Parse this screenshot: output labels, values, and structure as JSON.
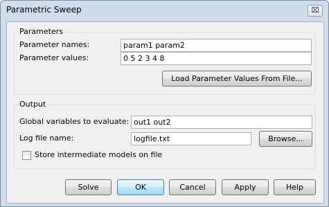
{
  "window": {
    "title": "Parametric Sweep",
    "close_glyph": "⌧"
  },
  "parameters": {
    "group_title": "Parameters",
    "names_label": "Parameter names:",
    "names_value": "param1 param2",
    "values_label": "Parameter values:",
    "values_value": "0 5 2 3 4 8",
    "load_button": "Load Parameter Values From File..."
  },
  "output": {
    "group_title": "Output",
    "global_vars_label": "Global variables to evaluate:",
    "global_vars_value": "out1 out2",
    "logfile_label": "Log file name:",
    "logfile_value": "logfile.txt",
    "browse_button": "Browse...",
    "store_checkbox_label": "Store intermediate models on file",
    "store_checked": false
  },
  "buttons": {
    "solve": "Solve",
    "ok": "OK",
    "cancel": "Cancel",
    "apply": "Apply",
    "help": "Help"
  },
  "colors": {
    "frame": "#cfdcea",
    "client": "#f0f0f0",
    "default_button": "#bee6fd"
  },
  "icons": [
    "close-icon"
  ]
}
